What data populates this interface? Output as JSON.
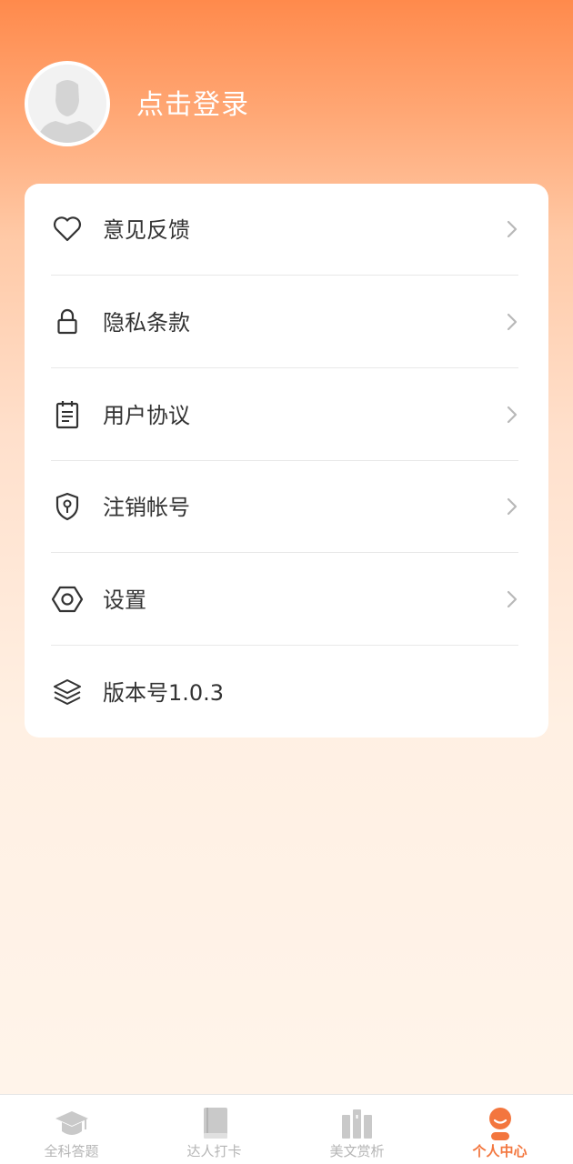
{
  "header": {
    "login_text": "点击登录"
  },
  "menu": {
    "items": [
      {
        "label": "意见反馈",
        "icon": "heart-icon",
        "has_arrow": true
      },
      {
        "label": "隐私条款",
        "icon": "lock-icon",
        "has_arrow": true
      },
      {
        "label": "用户协议",
        "icon": "notepad-icon",
        "has_arrow": true
      },
      {
        "label": "注销帐号",
        "icon": "shield-key-icon",
        "has_arrow": true
      },
      {
        "label": "设置",
        "icon": "hex-nut-icon",
        "has_arrow": true
      },
      {
        "label": "版本号1.0.3",
        "icon": "layers-icon",
        "has_arrow": false
      }
    ]
  },
  "tabbar": {
    "tabs": [
      {
        "label": "全科答题",
        "icon": "graduation-cap-icon",
        "active": false
      },
      {
        "label": "达人打卡",
        "icon": "book-icon",
        "active": false
      },
      {
        "label": "美文赏析",
        "icon": "bookshelf-icon",
        "active": false
      },
      {
        "label": "个人中心",
        "icon": "person-icon",
        "active": true
      }
    ]
  },
  "colors": {
    "accent": "#f3763e",
    "header_gradient_top": "#ff8a4c",
    "background": "#fff4ea",
    "inactive_tab": "#b5b5b5",
    "text": "#333333"
  }
}
